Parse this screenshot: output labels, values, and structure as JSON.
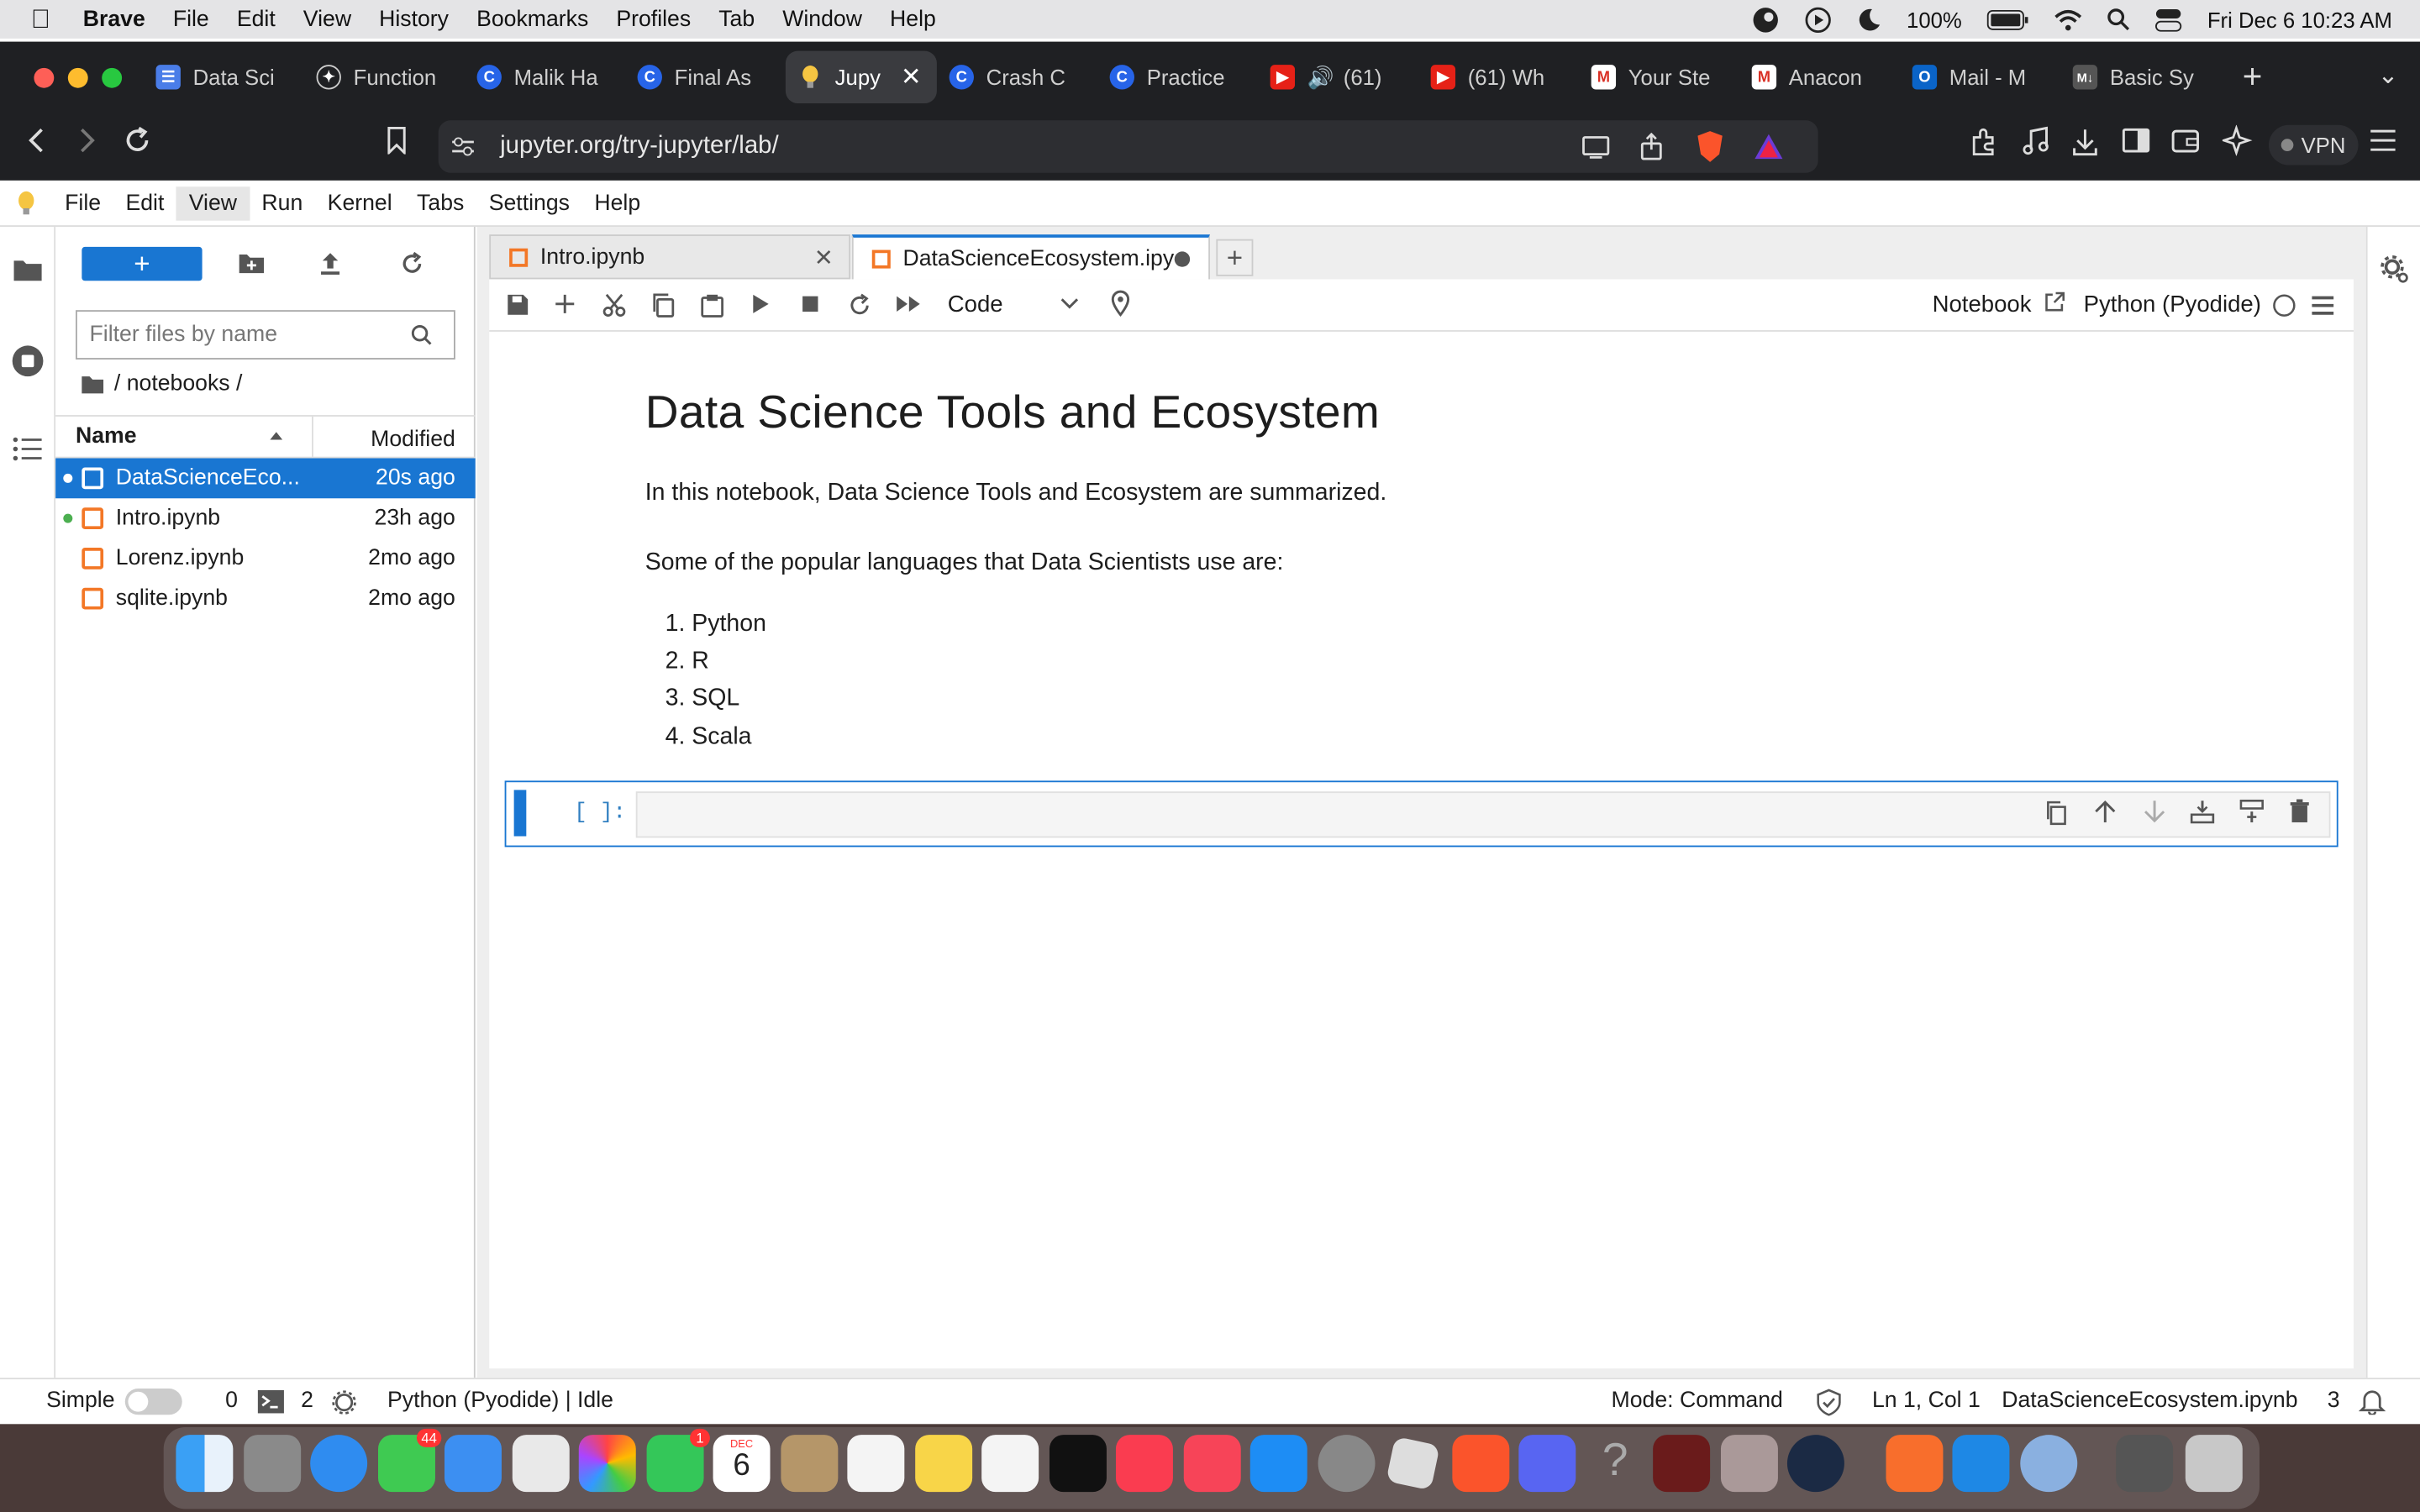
{
  "mac_menubar": {
    "app": "Brave",
    "items": [
      "File",
      "Edit",
      "View",
      "History",
      "Bookmarks",
      "Profiles",
      "Tab",
      "Window",
      "Help"
    ],
    "battery": "100%",
    "datetime": "Fri Dec 6  10:23 AM"
  },
  "browser": {
    "tabs": [
      {
        "label": "Data Sci",
        "color": "#4a7de8"
      },
      {
        "label": "Function",
        "color": "#444"
      },
      {
        "label": "Malik Ha",
        "color": "#2764e8"
      },
      {
        "label": "Final As",
        "color": "#2764e8"
      },
      {
        "label": "Jupy",
        "color": "#f5a623"
      },
      {
        "label": "Crash C",
        "color": "#2764e8"
      },
      {
        "label": "Practice",
        "color": "#2764e8"
      },
      {
        "label": "(61)",
        "color": "#e62117"
      },
      {
        "label": "(61) Wh",
        "color": "#e62117"
      },
      {
        "label": "Your Ste",
        "color": "#d93025"
      },
      {
        "label": "Anacon",
        "color": "#d93025"
      },
      {
        "label": "Mail - M",
        "color": "#0a64c8"
      },
      {
        "label": "Basic Sy",
        "color": "#666"
      }
    ],
    "url": "jupyter.org/try-jupyter/lab/",
    "vpn": "VPN"
  },
  "jupyter_menu": [
    "File",
    "Edit",
    "View",
    "Run",
    "Kernel",
    "Tabs",
    "Settings",
    "Help"
  ],
  "file_browser": {
    "filter_placeholder": "Filter files by name",
    "breadcrumb": "/ notebooks /",
    "col_name": "Name",
    "col_modified": "Modified",
    "files": [
      {
        "name": "DataScienceEco...",
        "modified": "20s ago"
      },
      {
        "name": "Intro.ipynb",
        "modified": "23h ago"
      },
      {
        "name": "Lorenz.ipynb",
        "modified": "2mo ago"
      },
      {
        "name": "sqlite.ipynb",
        "modified": "2mo ago"
      }
    ]
  },
  "doc_tabs": [
    "Intro.ipynb",
    "DataScienceEcosystem.ipy"
  ],
  "toolbar": {
    "cell_type": "Code",
    "notebook_label": "Notebook",
    "kernel": "Python (Pyodide)"
  },
  "notebook": {
    "title": "Data Science Tools and Ecosystem",
    "intro": "In this notebook, Data Science Tools and Ecosystem are summarized.",
    "languages_intro": "Some of the popular languages that Data Scientists use are:",
    "languages": [
      "1. Python",
      "2. R",
      "3. SQL",
      "4. Scala"
    ],
    "prompt": "[ ]:"
  },
  "statusbar": {
    "mode_label": "Simple",
    "count_a": "0",
    "count_b": "2",
    "kernel_status": "Python (Pyodide) | Idle",
    "mode": "Mode: Command",
    "position": "Ln 1, Col 1",
    "filename": "DataScienceEcosystem.ipynb",
    "notif_count": "3"
  },
  "dock": {
    "messages_badge": "44",
    "facetime_badge": "1",
    "calendar_month": "DEC",
    "calendar_day": "6"
  }
}
